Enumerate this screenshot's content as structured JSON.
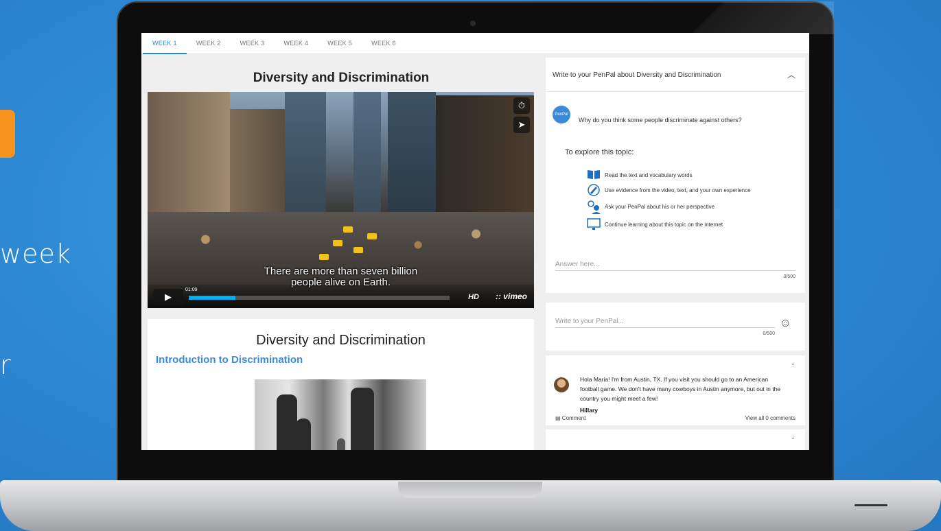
{
  "side": {
    "line1": "week",
    "line2": "r"
  },
  "tabs": [
    {
      "label": "WEEK 1"
    },
    {
      "label": "WEEK 2"
    },
    {
      "label": "WEEK 3"
    },
    {
      "label": "WEEK 4"
    },
    {
      "label": "WEEK 5"
    },
    {
      "label": "WEEK 6"
    }
  ],
  "video": {
    "title": "Diversity and Discrimination",
    "caption_line1": "There are more than seven billion",
    "caption_line2": "people alive on Earth.",
    "time": "01:09",
    "hd": "HD",
    "brand": ":: vimeo",
    "progress": 0.18
  },
  "article": {
    "title": "Diversity and Discrimination",
    "subtitle": "Introduction to Discrimination"
  },
  "prompt_card": {
    "header": "Write to your PenPal about Diversity and Discrimination",
    "logo_text": "PenPal",
    "question": "Why do you think some people discriminate against others?",
    "explore_title": "To explore this topic:",
    "items": [
      {
        "label": "Read the text and vocabulary words",
        "icon": "book-icon"
      },
      {
        "label": "Use evidence from the video, text, and your own experience",
        "icon": "pencil-icon"
      },
      {
        "label": "Ask your PenPal about his or her perspective",
        "icon": "people-icon"
      },
      {
        "label": "Continue learning about this topic on the internet",
        "icon": "monitor-icon"
      }
    ],
    "answer_placeholder": "Answer here...",
    "answer_count": "0/500"
  },
  "write_card": {
    "placeholder": "Write to your PenPal...",
    "count": "0/500"
  },
  "message_card": {
    "message": "Hola Maria! I'm from Austin, TX. If you visit you should go to an American football game. We don't have many cowboys in Austin anymore, but out in the country you might meet a few!",
    "author": "Hillary",
    "comment_label": "Comment",
    "view_all": "View all 0 comments"
  },
  "colors": {
    "accent": "#1e88e5",
    "link": "#3b8ad9",
    "orange": "#f7941d"
  }
}
